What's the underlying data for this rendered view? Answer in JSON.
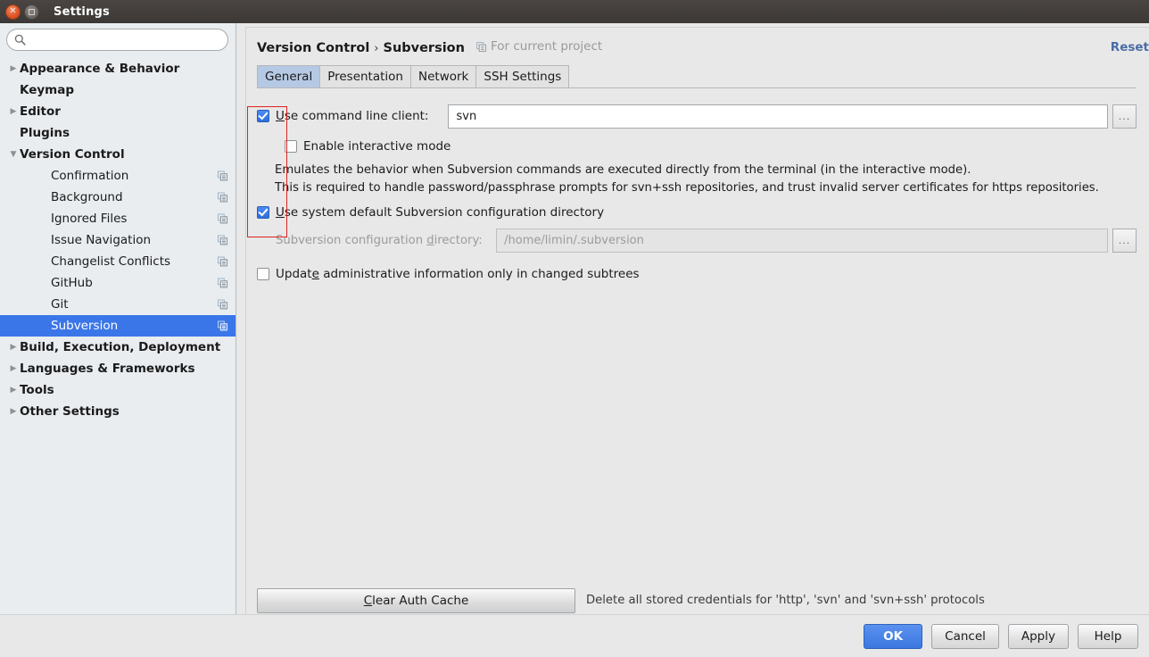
{
  "window": {
    "title": "Settings",
    "close_icon": "close-icon",
    "maximize_icon": "maximize-icon"
  },
  "search": {
    "placeholder": "",
    "value": "",
    "icon": "search-icon"
  },
  "sidebar": {
    "items": [
      {
        "label": "Appearance & Behavior",
        "level": "top",
        "arrow": "collapsed",
        "config_icon": false,
        "selected": false
      },
      {
        "label": "Keymap",
        "level": "top",
        "arrow": "none",
        "config_icon": false,
        "selected": false
      },
      {
        "label": "Editor",
        "level": "top",
        "arrow": "collapsed",
        "config_icon": false,
        "selected": false
      },
      {
        "label": "Plugins",
        "level": "top",
        "arrow": "none",
        "config_icon": false,
        "selected": false
      },
      {
        "label": "Version Control",
        "level": "top",
        "arrow": "expanded",
        "config_icon": false,
        "selected": false
      },
      {
        "label": "Confirmation",
        "level": "child",
        "arrow": "none",
        "config_icon": true,
        "selected": false
      },
      {
        "label": "Background",
        "level": "child",
        "arrow": "none",
        "config_icon": true,
        "selected": false
      },
      {
        "label": "Ignored Files",
        "level": "child",
        "arrow": "none",
        "config_icon": true,
        "selected": false
      },
      {
        "label": "Issue Navigation",
        "level": "child",
        "arrow": "none",
        "config_icon": true,
        "selected": false
      },
      {
        "label": "Changelist Conflicts",
        "level": "child",
        "arrow": "none",
        "config_icon": true,
        "selected": false
      },
      {
        "label": "GitHub",
        "level": "child",
        "arrow": "none",
        "config_icon": true,
        "selected": false
      },
      {
        "label": "Git",
        "level": "child",
        "arrow": "none",
        "config_icon": true,
        "selected": false
      },
      {
        "label": "Subversion",
        "level": "child",
        "arrow": "none",
        "config_icon": true,
        "selected": true
      },
      {
        "label": "Build, Execution, Deployment",
        "level": "top",
        "arrow": "collapsed",
        "config_icon": false,
        "selected": false
      },
      {
        "label": "Languages & Frameworks",
        "level": "top",
        "arrow": "collapsed",
        "config_icon": false,
        "selected": false
      },
      {
        "label": "Tools",
        "level": "top",
        "arrow": "collapsed",
        "config_icon": false,
        "selected": false
      },
      {
        "label": "Other Settings",
        "level": "top",
        "arrow": "collapsed",
        "config_icon": false,
        "selected": false
      }
    ]
  },
  "header": {
    "breadcrumb_root": "Version Control",
    "breadcrumb_sep": "›",
    "breadcrumb_leaf": "Subversion",
    "scope_label": "For current project",
    "scope_icon": "project-scope-icon",
    "reset_label": "Reset"
  },
  "tabs": [
    {
      "label": "General",
      "active": true
    },
    {
      "label": "Presentation",
      "active": false
    },
    {
      "label": "Network",
      "active": false
    },
    {
      "label": "SSH Settings",
      "active": false
    }
  ],
  "general": {
    "use_command_line": {
      "label": "Use command line client:",
      "checked": true,
      "value": "svn",
      "browse_label": "..."
    },
    "enable_interactive": {
      "label": "Enable interactive mode",
      "checked": false
    },
    "description_line1": "Emulates the behavior when Subversion commands are executed directly from the terminal (in the interactive mode).",
    "description_line2": "This is required to handle password/passphrase prompts for svn+ssh repositories, and trust invalid server certificates for https repositories.",
    "use_system_default": {
      "label": "Use system default Subversion configuration directory",
      "checked": true
    },
    "config_directory": {
      "label": "Subversion configuration directory:",
      "value": "/home/limin/.subversion",
      "disabled": true,
      "browse_label": "..."
    },
    "update_admin_info": {
      "label": "Update administrative information only in changed subtrees",
      "checked": false
    },
    "clear_auth_cache": {
      "button_label": "Clear Auth Cache",
      "description": "Delete all stored credentials for 'http', 'svn' and 'svn+ssh' protocols"
    }
  },
  "footer": {
    "buttons": [
      {
        "label": "OK",
        "primary": true
      },
      {
        "label": "Cancel",
        "primary": false
      },
      {
        "label": "Apply",
        "primary": false
      },
      {
        "label": "Help",
        "primary": false
      }
    ]
  },
  "annotation": {
    "color": "#e02222",
    "shape": "rectangle"
  }
}
